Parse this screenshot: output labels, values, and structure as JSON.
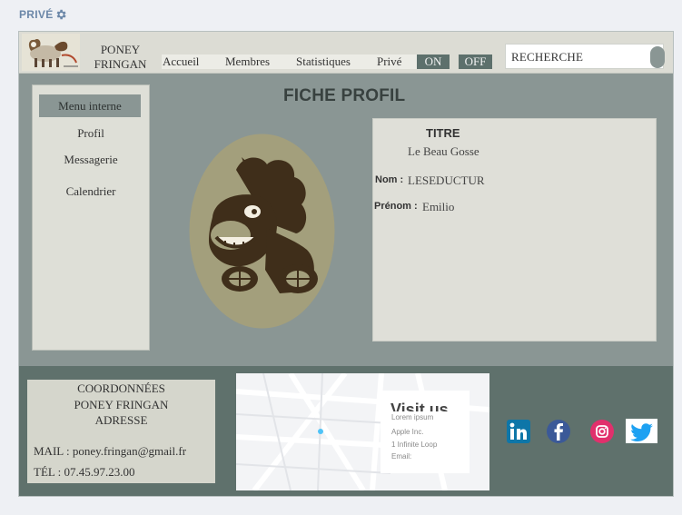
{
  "topbar": {
    "label": "PRIVÉ",
    "settings_icon": "gear-icon"
  },
  "header": {
    "brand_line1": "PONEY",
    "brand_line2": "FRINGAN",
    "nav": [
      "Accueil",
      "Membres",
      "Statistiques",
      "Privé"
    ],
    "toggle_on": "ON",
    "toggle_off": "OFF",
    "search_placeholder": "RECHERCHE"
  },
  "sidebar": {
    "title": "Menu interne",
    "items": [
      "Profil",
      "Messagerie",
      "Calendrier"
    ]
  },
  "main": {
    "title": "FICHE PROFIL",
    "card": {
      "title": "TITRE",
      "subtitle": "Le Beau Gosse",
      "nom_label": "Nom :",
      "nom_value": "LESEDUCTUR",
      "prenom_label": "Prénom :",
      "prenom_value": "Emilio"
    }
  },
  "footer": {
    "contact_title": "COORDONNÉES",
    "contact_name": "PONEY FRINGAN",
    "contact_address": "ADRESSE",
    "mail": "MAIL : poney.fringan@gmail.fr",
    "tel": "TÉL : 07.45.97.23.00",
    "map": {
      "heading": "Visit us",
      "lines": [
        "Lorem ipsum",
        "Apple Inc.",
        "1 Infinite Loop",
        "Email:"
      ]
    },
    "social": [
      "linkedin-icon",
      "facebook-icon",
      "instagram-icon",
      "twitter-icon"
    ]
  },
  "colors": {
    "frame": "#8a9694",
    "header": "#dcdcd4",
    "footer": "#5f716c",
    "toggle": "#5d706c",
    "avatar_bg": "#a39f7c",
    "facebook": "#3b5998",
    "instagram": "#e1306c",
    "twitter": "#1da1f2",
    "linkedin": "#0e76a8"
  }
}
